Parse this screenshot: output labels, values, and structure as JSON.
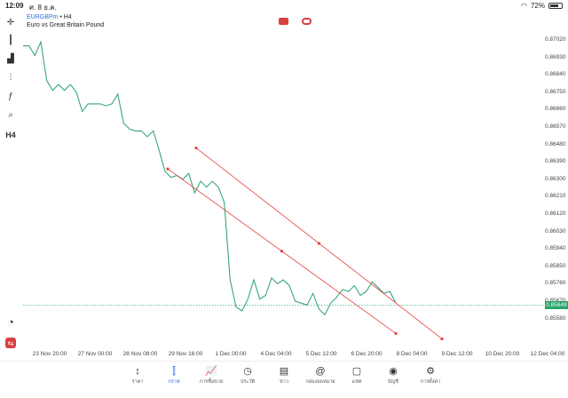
{
  "status": {
    "time": "12:09",
    "date": "ศ. 8 ธ.ค.",
    "battery": "72%",
    "battery_level": 0.72
  },
  "symbol": {
    "name": "EURGBPm",
    "timeframe": "H4",
    "description": "Euro vs Great Britain Pound"
  },
  "toolbar": [
    {
      "name": "crosshair-icon",
      "glyph": "✛"
    },
    {
      "name": "candlestick-icon",
      "glyph": "┃"
    },
    {
      "name": "bar-chart-icon",
      "glyph": "▟"
    },
    {
      "name": "indicators-icon",
      "glyph": "⫶"
    },
    {
      "name": "function-icon",
      "glyph": "ƒ"
    },
    {
      "name": "objects-icon",
      "glyph": "⌕"
    },
    {
      "name": "timeframe-label",
      "glyph": "H4"
    }
  ],
  "price_axis": [
    "0.87020",
    "0.86930",
    "0.86840",
    "0.86750",
    "0.86660",
    "0.86570",
    "0.86480",
    "0.86390",
    "0.86300",
    "0.86210",
    "0.86120",
    "0.86030",
    "0.85940",
    "0.85850",
    "0.85760",
    "0.85670",
    "0.85580"
  ],
  "current_price": "0.85649",
  "time_axis": [
    "23 Nov 20:00",
    "27 Nov 00:00",
    "28 Nov 08:00",
    "29 Nov 16:00",
    "1 Dec 00:00",
    "4 Dec 04:00",
    "5 Dec 12:00",
    "6 Dec 20:00",
    "8 Dec 04:00",
    "9 Dec 12:00",
    "10 Dec 20:00",
    "12 Dec 04:00"
  ],
  "colors": {
    "line": "#3aa67a",
    "channel": "#e04040",
    "price_tag": "#26a269",
    "accent": "#2a6fdb"
  },
  "nav": [
    {
      "icon": "↕",
      "label": "ราคา",
      "name": "quotes"
    },
    {
      "icon": "⫿",
      "label": "กราฟ",
      "name": "chart",
      "active": true
    },
    {
      "icon": "📈",
      "label": "การซื้อขาย",
      "name": "trade"
    },
    {
      "icon": "◷",
      "label": "ประวัติ",
      "name": "history"
    },
    {
      "icon": "▤",
      "label": "ข่าว",
      "name": "news"
    },
    {
      "icon": "@",
      "label": "กล่องจดหมาย",
      "name": "mailbox"
    },
    {
      "icon": "▢",
      "label": "แชท",
      "name": "chat"
    },
    {
      "icon": "◉",
      "label": "บัญชี",
      "name": "account"
    },
    {
      "icon": "⚙",
      "label": "การตั้งค่า",
      "name": "settings"
    }
  ],
  "chart_data": {
    "type": "line",
    "y": [
      0.8699,
      0.8699,
      0.8694,
      0.8701,
      0.8681,
      0.8676,
      0.8679,
      0.8676,
      0.8679,
      0.8675,
      0.8665,
      0.8669,
      0.8669,
      0.8669,
      0.8668,
      0.8669,
      0.8674,
      0.8659,
      0.8656,
      0.8655,
      0.8655,
      0.8652,
      0.8655,
      0.8645,
      0.8634,
      0.8631,
      0.8632,
      0.863,
      0.8633,
      0.8623,
      0.8629,
      0.8626,
      0.8629,
      0.8626,
      0.8618,
      0.8578,
      0.8564,
      0.8562,
      0.8568,
      0.8578,
      0.8568,
      0.857,
      0.8579,
      0.8576,
      0.8578,
      0.8575,
      0.8567,
      0.8566,
      0.8565,
      0.8571,
      0.8563,
      0.856,
      0.8566,
      0.8569,
      0.8573,
      0.8572,
      0.8575,
      0.857,
      0.8572,
      0.8577,
      0.8574,
      0.8571,
      0.8572,
      0.8566
    ],
    "channel_upper": [
      [
        0.86462,
        0.0
      ],
      [
        0.85475,
        1.0
      ]
    ],
    "channel_lower": [
      [
        0.86354,
        0.0
      ],
      [
        0.85503,
        1.0
      ]
    ],
    "ylim": [
      0.855,
      0.8708
    ],
    "current_price": 0.85649
  }
}
